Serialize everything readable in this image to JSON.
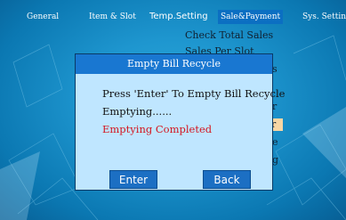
{
  "tabs": [
    {
      "label": "General"
    },
    {
      "label": "Item & Slot"
    },
    {
      "label": "Temp.Setting"
    },
    {
      "label": "Sale&Payment"
    },
    {
      "label": "Sys. Setting"
    }
  ],
  "background_menu": {
    "items": [
      {
        "label": "Check Total Sales"
      },
      {
        "label": "Sales Per Slot"
      },
      {
        "label": "s"
      },
      {
        "label": "r"
      },
      {
        "label": "r"
      },
      {
        "label": "e"
      },
      {
        "label": "g"
      }
    ]
  },
  "dialog": {
    "title": "Empty Bill Recycle",
    "line1": "Press 'Enter' To Empty Bill Recycle",
    "line2": "Emptying......",
    "line3": "Emptying Completed",
    "enter_label": "Enter",
    "back_label": "Back"
  },
  "colors": {
    "tab_active": "#0b6fc2",
    "title_bar": "#1977d1",
    "dialog_body": "#bfe6ff",
    "completed_text": "#d4151f",
    "highlight": "#f7d6a4"
  }
}
